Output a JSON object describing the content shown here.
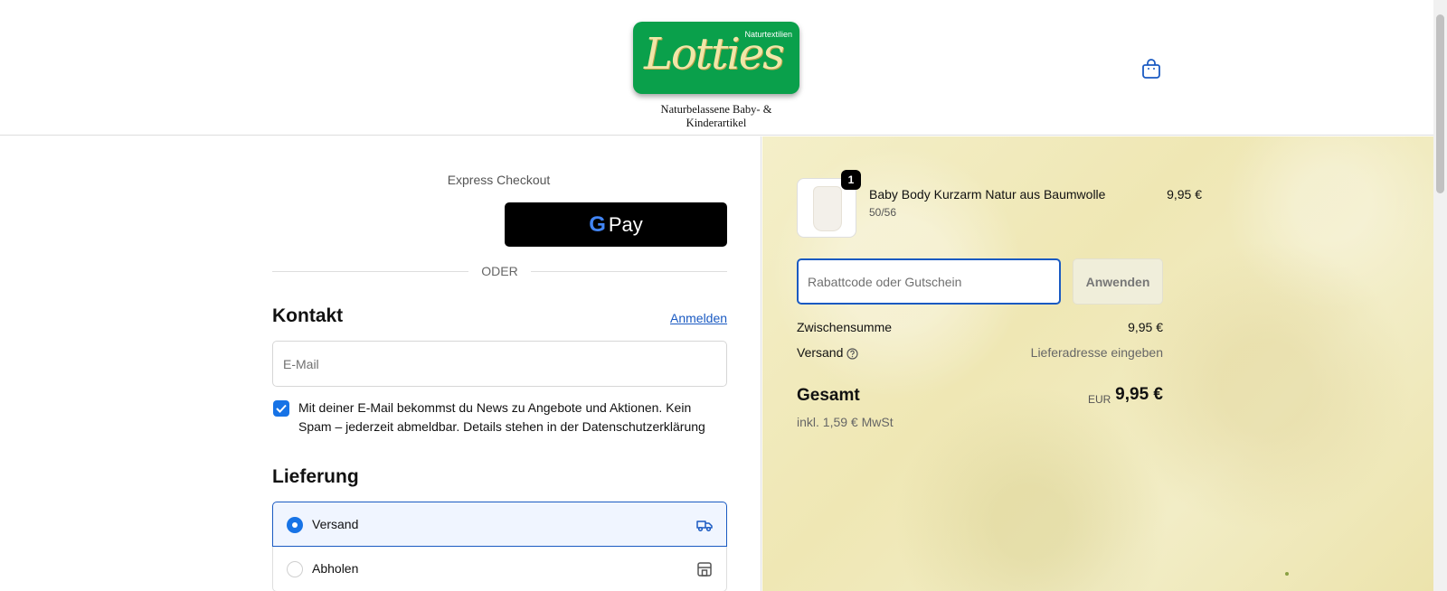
{
  "header": {
    "logo": {
      "brand": "Lotties",
      "small_text": "Naturtextilien",
      "tagline": "Naturbelassene Baby- & Kinderartikel"
    },
    "cart_icon": "shopping-bag-icon"
  },
  "express": {
    "title": "Express Checkout",
    "gpay_label": "Pay",
    "gpay_g": "G",
    "divider": "ODER"
  },
  "contact": {
    "heading": "Kontakt",
    "login_link": "Anmelden",
    "email_placeholder": "E-Mail",
    "newsletter_checked": true,
    "newsletter_text": "Mit deiner E-Mail bekommst du News zu Angebote und Aktionen. Kein Spam – jederzeit abmeldbar. Details stehen in der Datenschutzerklärung"
  },
  "delivery": {
    "heading": "Lieferung",
    "options": [
      {
        "label": "Versand",
        "selected": true,
        "icon": "delivery-truck-icon"
      },
      {
        "label": "Abholen",
        "selected": false,
        "icon": "store-icon"
      }
    ]
  },
  "summary": {
    "item": {
      "quantity": "1",
      "name": "Baby Body Kurzarm Natur aus Baumwolle",
      "variant": "50/56",
      "price": "9,95 €"
    },
    "discount_placeholder": "Rabattcode oder Gutschein",
    "apply_label": "Anwenden",
    "subtotal_label": "Zwischensumme",
    "subtotal_value": "9,95 €",
    "shipping_label": "Versand",
    "shipping_value": "Lieferadresse eingeben",
    "total_label": "Gesamt",
    "currency": "EUR",
    "total_value": "9,95 €",
    "tax_note": "inkl. 1,59 € MwSt"
  },
  "colors": {
    "accent": "#1773e6",
    "link": "#1a5ac2",
    "logo_green": "#0aa04b"
  }
}
